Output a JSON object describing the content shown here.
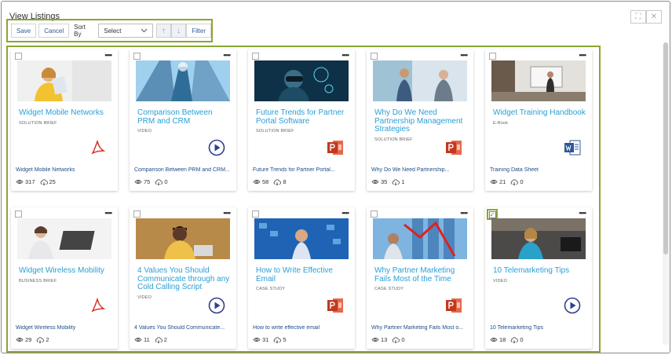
{
  "window": {
    "title": "View Listings"
  },
  "toolbar": {
    "save": "Save",
    "cancel": "Cancel",
    "sort_label": "Sort By",
    "sort_value": "Select",
    "filter": "Filter"
  },
  "cards": [
    {
      "title": "Widget Mobile Networks",
      "type": "SOLUTION BRIEF",
      "footer": "Widget Mobile Networks",
      "views": "317",
      "downloads": "25",
      "file": "pdf",
      "checked": false
    },
    {
      "title": "Comparison Between PRM and CRM",
      "type": "VIDEO",
      "footer": "Comparison Between PRM and CRM...",
      "views": "75",
      "downloads": "0",
      "file": "video",
      "checked": false
    },
    {
      "title": "Future Trends for Partner Portal Software",
      "type": "SOLUTION BRIEF",
      "footer": "Future Trends for Partner Portal...",
      "views": "58",
      "downloads": "8",
      "file": "ppt",
      "checked": false
    },
    {
      "title": "Why Do We Need Partnership Management Strategies",
      "type": "SOLUTION BRIEF",
      "footer": "Why Do We Need Partnership...",
      "views": "35",
      "downloads": "1",
      "file": "ppt",
      "checked": false
    },
    {
      "title": "Widget Training Handbook",
      "type": "E-Book",
      "footer": "Training Data Sheet",
      "views": "21",
      "downloads": "0",
      "file": "word",
      "checked": false
    },
    {
      "title": "Widget Wireless Mobility",
      "type": "BUSINESS BRIEF",
      "footer": "Widget Wireless Mobility",
      "views": "29",
      "downloads": "2",
      "file": "pdf",
      "checked": false
    },
    {
      "title": "4 Values You Should Communicate through any Cold Calling Script",
      "type": "VIDEO",
      "footer": "4 Values You Should Communicate...",
      "views": "11",
      "downloads": "2",
      "file": "video",
      "checked": false
    },
    {
      "title": "How to Write Effective Email",
      "type": "CASE STUDY",
      "footer": "How to write effective email",
      "views": "31",
      "downloads": "5",
      "file": "ppt",
      "checked": false
    },
    {
      "title": "Why Partner Marketing Fails Most of the Time",
      "type": "CASE STUDY",
      "footer": "Why Partner Marketing Fails Most o...",
      "views": "13",
      "downloads": "0",
      "file": "ppt",
      "checked": false
    },
    {
      "title": "10 Telemarketing Tips",
      "type": "VIDEO",
      "footer": "10 Telemarketing Tips",
      "views": "18",
      "downloads": "0",
      "file": "video",
      "checked": true
    }
  ],
  "colors": {
    "accent": "#2a9fd6",
    "highlight": "#8aa632",
    "link": "#1d4d8c"
  }
}
